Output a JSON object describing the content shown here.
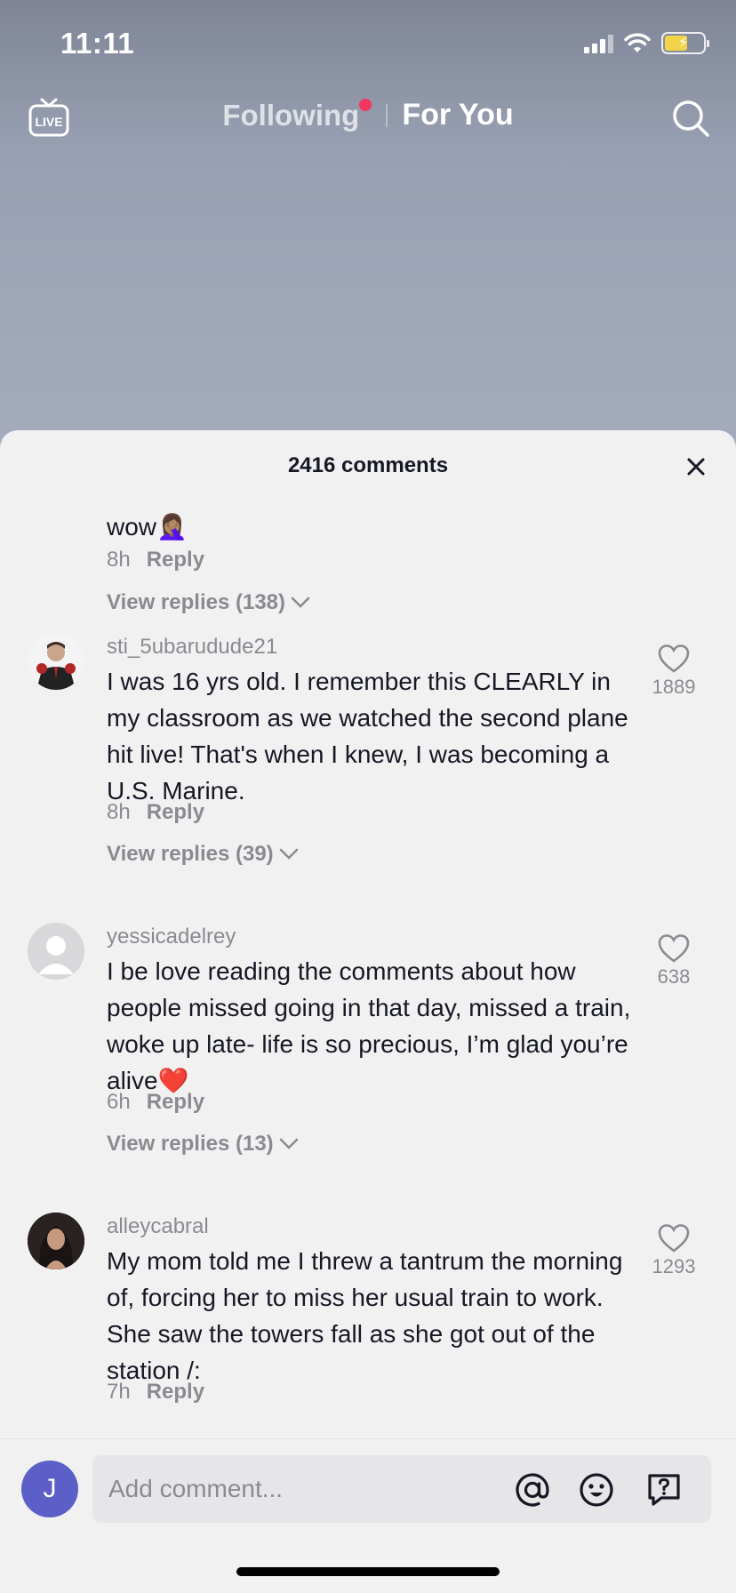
{
  "status_bar": {
    "time": "11:11"
  },
  "top_nav": {
    "following_label": "Following",
    "for_you_label": "For You"
  },
  "sheet": {
    "title": "2416 comments"
  },
  "comments": [
    {
      "username": "",
      "text": "wow🤦🏽‍♀️",
      "time": "8h",
      "reply_label": "Reply",
      "view_replies": "View replies (138)"
    },
    {
      "username": "sti_5ubarudude21",
      "text": "I was 16 yrs old. I remember this CLEARLY in my classroom as we watched the second plane hit live! That's when I knew, I was becoming a U.S. Marine.",
      "time": "8h",
      "reply_label": "Reply",
      "view_replies": "View replies (39)",
      "likes": "1889"
    },
    {
      "username": "yessicadelrey",
      "text": "I be love reading the comments about how people missed going in that day, missed a train, woke up late- life is so precious, I’m glad you’re alive❤️",
      "time": "6h",
      "reply_label": "Reply",
      "view_replies": "View replies (13)",
      "likes": "638"
    },
    {
      "username": "alleycabral",
      "text": "My mom told me I threw a tantrum the morning of, forcing her to miss her usual train to work. She saw the towers fall as she got out of the station /:",
      "time": "7h",
      "reply_label": "Reply",
      "likes": "1293"
    }
  ],
  "input": {
    "avatar_letter": "J",
    "placeholder": "Add comment..."
  },
  "colors": {
    "accent_dot": "#f2375f",
    "user_avatar": "#5b5fc7",
    "sheet_bg": "#f1f1f2"
  },
  "icons": [
    "live-icon",
    "search-icon",
    "close-icon",
    "heart-icon",
    "chevron-down-icon",
    "mention-icon",
    "emoji-icon",
    "question-icon"
  ]
}
